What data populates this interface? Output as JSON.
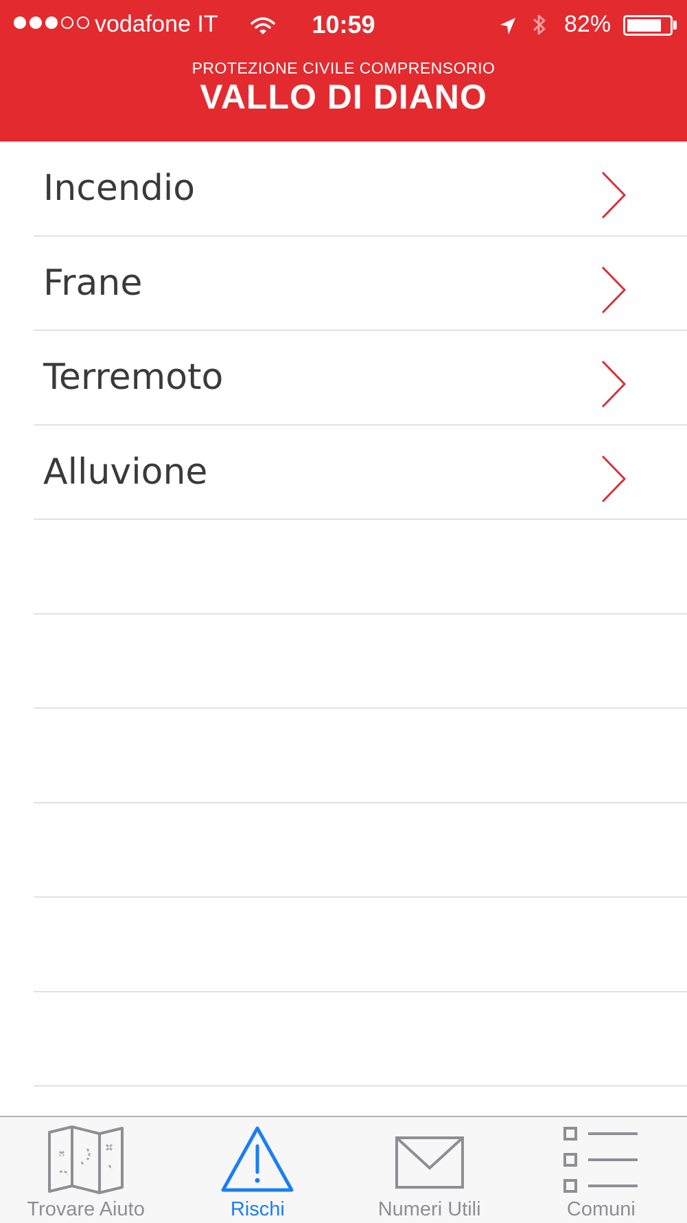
{
  "status_bar": {
    "carrier": "vodafone IT",
    "time": "10:59",
    "battery_percent": "82%",
    "battery_level": 0.82,
    "signal_bars_filled": 3,
    "signal_bars_total": 5
  },
  "header": {
    "subtitle": "PROTEZIONE CIVILE COMPRENSORIO",
    "title": "VALLO DI DIANO",
    "background_color": "#e32b2f"
  },
  "risks_list": {
    "items": [
      {
        "label": "Incendio",
        "icon": "chevron-right-icon"
      },
      {
        "label": "Frane",
        "icon": "chevron-right-icon"
      },
      {
        "label": "Terremoto",
        "icon": "chevron-right-icon"
      },
      {
        "label": "Alluvione",
        "icon": "chevron-right-icon"
      }
    ],
    "empty_rows": 6,
    "chevron_color": "#d6323a"
  },
  "tab_bar": {
    "active_color": "#1a7ef5",
    "inactive_color": "#8e8e93",
    "tabs": [
      {
        "label": "Trovare Aiuto",
        "icon": "map-icon",
        "active": false
      },
      {
        "label": "Rischi",
        "icon": "warning-icon",
        "active": true
      },
      {
        "label": "Numeri Utili",
        "icon": "envelope-icon",
        "active": false
      },
      {
        "label": "Comuni",
        "icon": "list-icon",
        "active": false
      }
    ]
  }
}
